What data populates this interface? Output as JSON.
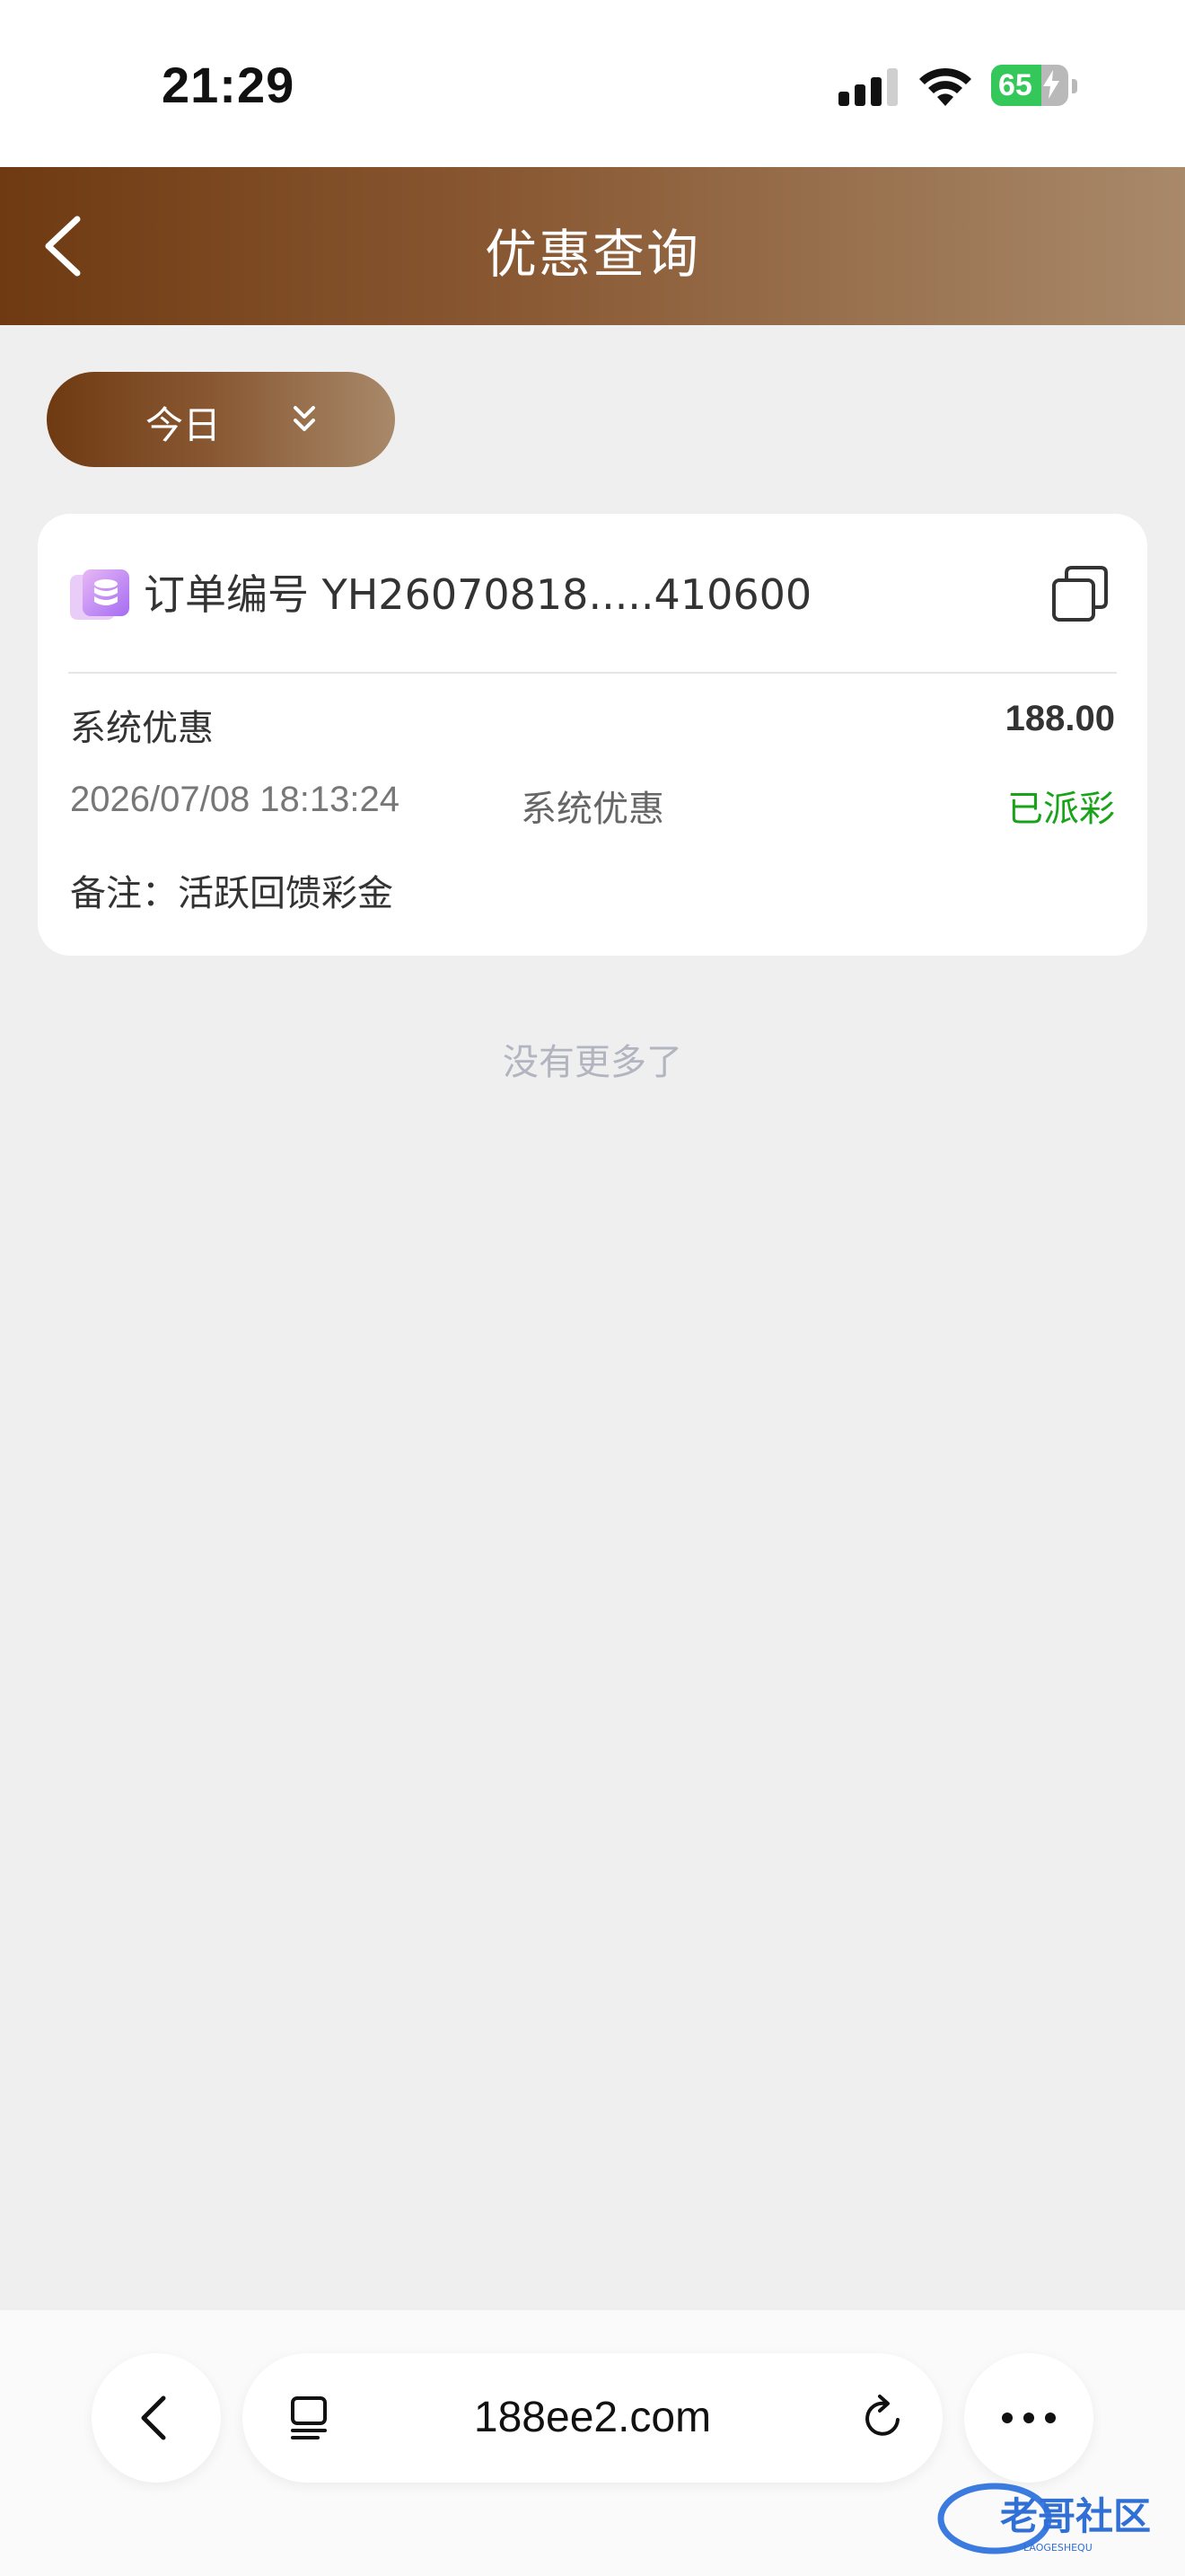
{
  "status_bar": {
    "time": "21:29",
    "battery": "65",
    "battery_level": 0.65
  },
  "header": {
    "title": "优惠查询",
    "back_icon": "chevron-left-icon"
  },
  "filter": {
    "label": "今日",
    "icon": "double-chevron-down-icon"
  },
  "record": {
    "order_label": "订单编号 YH26070818.....410600",
    "type": "系统优惠",
    "amount": "188.00",
    "datetime": "2026/07/08 18:13:24",
    "type_secondary": "系统优惠",
    "status": "已派彩",
    "remark": "备注：活跃回馈彩金"
  },
  "list_end_text": "没有更多了",
  "browser": {
    "url": "188ee2.com"
  },
  "watermark": {
    "text": "老哥社区",
    "sub": "LAOGESHEQU"
  },
  "colors": {
    "brand_dark": "#6f3a12",
    "brand_light": "#a8896a",
    "status_green": "#19a319",
    "background": "#efefef"
  }
}
